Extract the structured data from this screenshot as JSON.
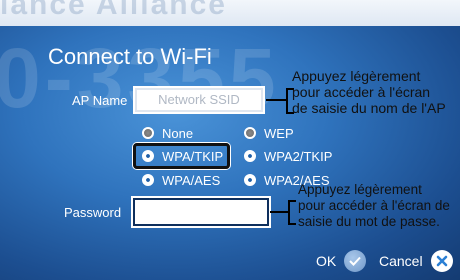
{
  "ghost_text": {
    "top": "iance Alliance",
    "number": "0-3355"
  },
  "dialog": {
    "title": "Connect to Wi-Fi",
    "ap_label": "AP Name",
    "ssid_value": "Network SSID",
    "password_label": "Password",
    "password_value": ""
  },
  "security_options": [
    {
      "label": "None",
      "selected": false
    },
    {
      "label": "WEP",
      "selected": false
    },
    {
      "label": "WPA/TKIP",
      "selected": true
    },
    {
      "label": "WPA2/TKIP",
      "selected": false
    },
    {
      "label": "WPA/AES",
      "selected": false
    },
    {
      "label": "WPA2/AES",
      "selected": false
    }
  ],
  "callouts": {
    "ssid": [
      "Appuyez légèrement",
      "pour accéder à l'écran",
      "de saisie du nom de l'AP"
    ],
    "password": [
      "Appuyez légèrement",
      "pour accéder à l'écran de",
      "saisie du mot de passe."
    ]
  },
  "buttons": {
    "ok": "OK",
    "cancel": "Cancel"
  },
  "icons": {
    "ok": "check-icon",
    "cancel": "close-icon"
  },
  "colors": {
    "background": "#2f73bd",
    "selected_radio": "#1f5fa8",
    "cancel_icon": "#2b7fd4"
  }
}
